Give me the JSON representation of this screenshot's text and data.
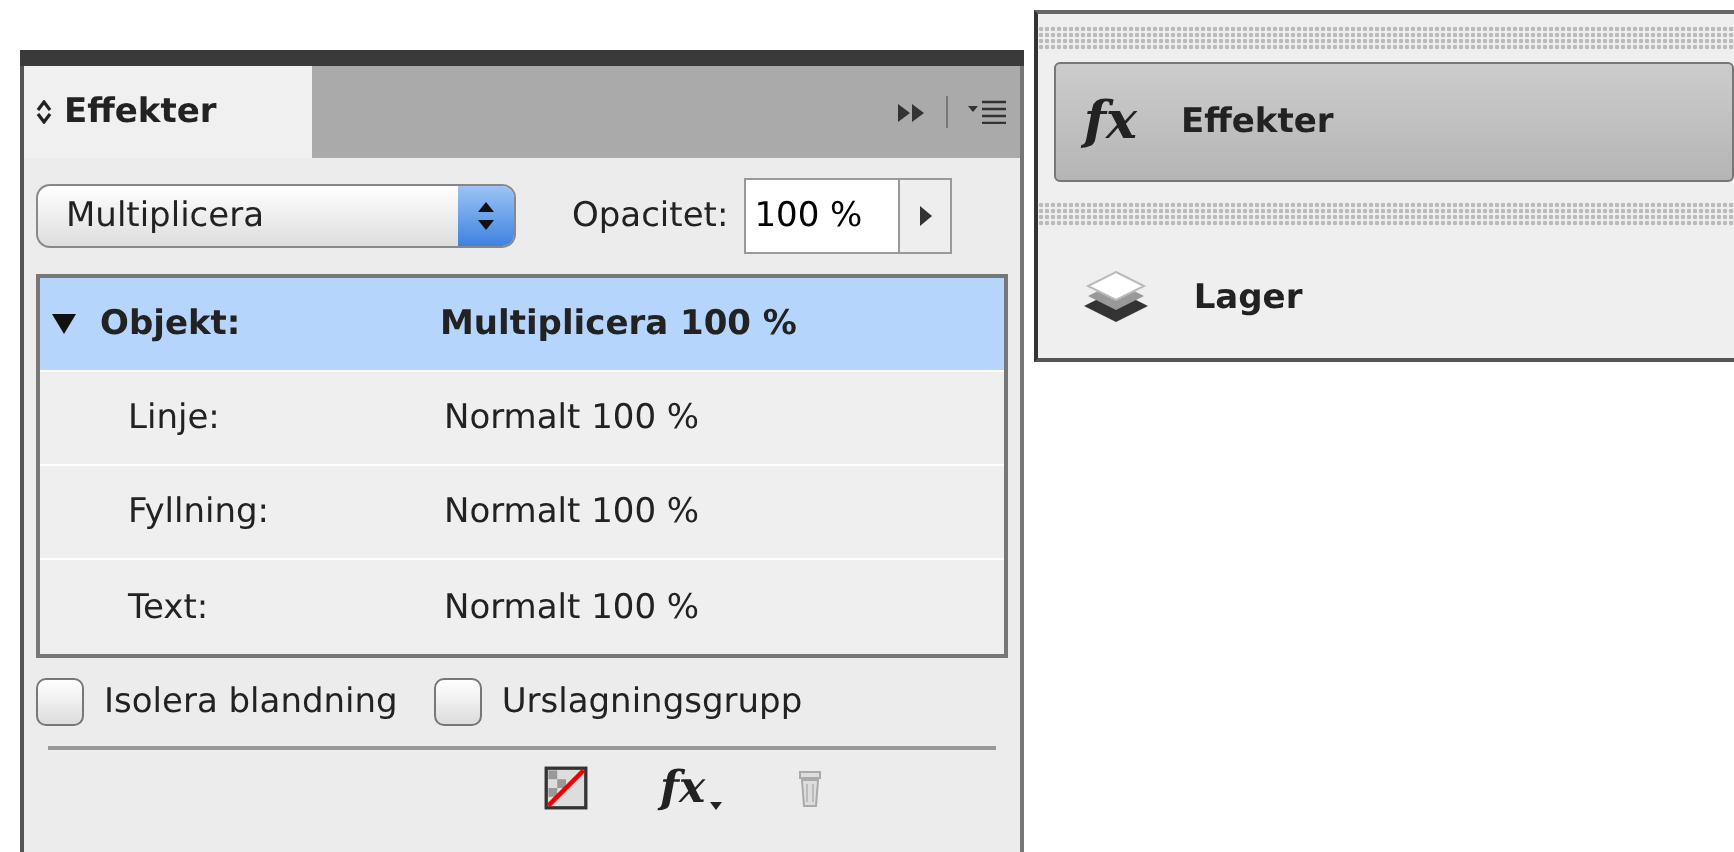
{
  "panel": {
    "tab": {
      "label": "Effekter",
      "selected": true
    },
    "blend_mode": "Multiplicera",
    "opacity_label": "Opacitet:",
    "opacity_value": "100 %",
    "rows": [
      {
        "label": "Objekt:",
        "value": "Multiplicera 100 %",
        "selected": true,
        "expanded": true,
        "children": [
          {
            "label": "Linje:",
            "value": "Normalt 100 %",
            "selected": false
          },
          {
            "label": "Fyllning:",
            "value": "Normalt 100 %",
            "selected": false
          },
          {
            "label": "Text:",
            "value": "Normalt 100 %",
            "selected": false
          }
        ]
      }
    ],
    "options": [
      {
        "label": "Isolera blandning",
        "checked": false
      },
      {
        "label": "Urslagningsgrupp",
        "checked": false
      }
    ],
    "footer": {
      "fx_label": "fx"
    }
  },
  "dock": {
    "items": [
      {
        "kind": "effects",
        "icon_text": "fx",
        "label": "Effekter",
        "selected": true
      },
      {
        "kind": "layers",
        "label": "Lager",
        "selected": false
      }
    ]
  }
}
